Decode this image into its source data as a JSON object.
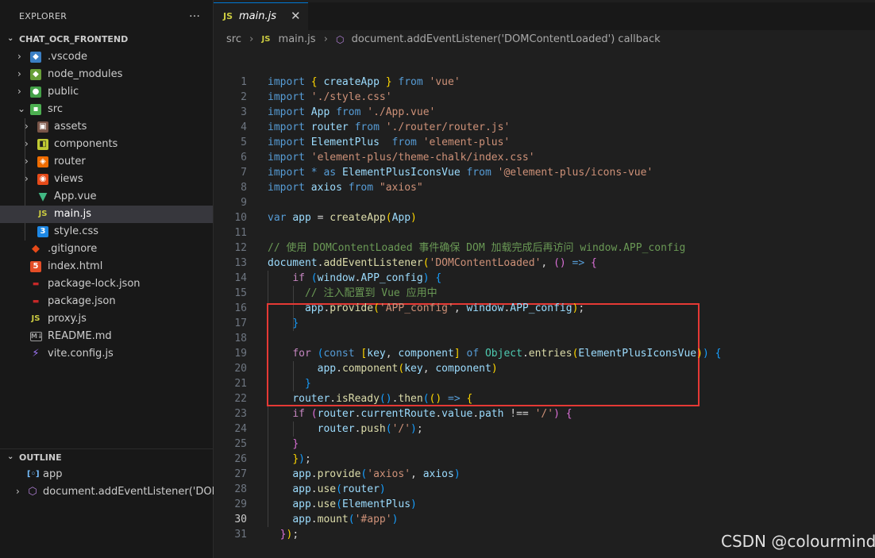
{
  "explorer": {
    "title": "EXPLORER",
    "more_icon": "…",
    "project_name": "CHAT_OCR_FRONTEND",
    "items": [
      {
        "label": ".vscode",
        "icon": "vscode-folder-icon"
      },
      {
        "label": "node_modules",
        "icon": "node-folder-icon"
      },
      {
        "label": "public",
        "icon": "public-folder-icon"
      },
      {
        "label": "src",
        "icon": "src-folder-icon"
      },
      {
        "label": "assets",
        "icon": "assets-folder-icon"
      },
      {
        "label": "components",
        "icon": "components-folder-icon"
      },
      {
        "label": "router",
        "icon": "router-folder-icon"
      },
      {
        "label": "views",
        "icon": "views-folder-icon"
      },
      {
        "label": "App.vue",
        "icon": "vue-file-icon"
      },
      {
        "label": "main.js",
        "icon": "js-file-icon"
      },
      {
        "label": "style.css",
        "icon": "css-file-icon"
      },
      {
        "label": ".gitignore",
        "icon": "git-file-icon"
      },
      {
        "label": "index.html",
        "icon": "html-file-icon"
      },
      {
        "label": "package-lock.json",
        "icon": "json-file-icon"
      },
      {
        "label": "package.json",
        "icon": "json-file-icon"
      },
      {
        "label": "proxy.js",
        "icon": "js-file-icon"
      },
      {
        "label": "README.md",
        "icon": "markdown-file-icon"
      },
      {
        "label": "vite.config.js",
        "icon": "vite-file-icon"
      }
    ]
  },
  "outline": {
    "title": "OUTLINE",
    "items": [
      {
        "label": "app",
        "icon": "variable-icon"
      },
      {
        "label": "document.addEventListener('DOMC...",
        "icon": "method-icon"
      }
    ]
  },
  "tab": {
    "badge": "JS",
    "label": "main.js",
    "close": "✕"
  },
  "breadcrumb": {
    "folder": "src",
    "file_badge": "JS",
    "file": "main.js",
    "symbol": "document.addEventListener('DOMContentLoaded') callback"
  },
  "editor": {
    "active_line": 30,
    "lines": [
      [
        [
          "kw",
          "import"
        ],
        [
          "t",
          " "
        ],
        [
          "b1",
          "{"
        ],
        [
          "t",
          " "
        ],
        [
          "var",
          "createApp"
        ],
        [
          "t",
          " "
        ],
        [
          "b1",
          "}"
        ],
        [
          "t",
          " "
        ],
        [
          "kw",
          "from"
        ],
        [
          "t",
          " "
        ],
        [
          "str",
          "'vue'"
        ]
      ],
      [
        [
          "kw",
          "import"
        ],
        [
          "t",
          " "
        ],
        [
          "str",
          "'./style.css'"
        ]
      ],
      [
        [
          "kw",
          "import"
        ],
        [
          "t",
          " "
        ],
        [
          "var",
          "App"
        ],
        [
          "t",
          " "
        ],
        [
          "kw",
          "from"
        ],
        [
          "t",
          " "
        ],
        [
          "str",
          "'./App.vue'"
        ]
      ],
      [
        [
          "kw",
          "import"
        ],
        [
          "t",
          " "
        ],
        [
          "var",
          "router"
        ],
        [
          "t",
          " "
        ],
        [
          "kw",
          "from"
        ],
        [
          "t",
          " "
        ],
        [
          "str",
          "'./router/router.js'"
        ]
      ],
      [
        [
          "kw",
          "import"
        ],
        [
          "t",
          " "
        ],
        [
          "var",
          "ElementPlus"
        ],
        [
          "t",
          "  "
        ],
        [
          "kw",
          "from"
        ],
        [
          "t",
          " "
        ],
        [
          "str",
          "'element-plus'"
        ]
      ],
      [
        [
          "kw",
          "import"
        ],
        [
          "t",
          " "
        ],
        [
          "str",
          "'element-plus/theme-chalk/index.css'"
        ]
      ],
      [
        [
          "kw",
          "import"
        ],
        [
          "t",
          " "
        ],
        [
          "kw",
          "*"
        ],
        [
          "t",
          " "
        ],
        [
          "kw",
          "as"
        ],
        [
          "t",
          " "
        ],
        [
          "var",
          "ElementPlusIconsVue"
        ],
        [
          "t",
          " "
        ],
        [
          "kw",
          "from"
        ],
        [
          "t",
          " "
        ],
        [
          "str",
          "'@element-plus/icons-vue'"
        ]
      ],
      [
        [
          "kw",
          "import"
        ],
        [
          "t",
          " "
        ],
        [
          "var",
          "axios"
        ],
        [
          "t",
          " "
        ],
        [
          "kw",
          "from"
        ],
        [
          "t",
          " "
        ],
        [
          "str",
          "\"axios\""
        ]
      ],
      [],
      [
        [
          "kw",
          "var"
        ],
        [
          "t",
          " "
        ],
        [
          "var",
          "app"
        ],
        [
          "t",
          " "
        ],
        [
          "pun",
          "="
        ],
        [
          "t",
          " "
        ],
        [
          "fn",
          "createApp"
        ],
        [
          "b1",
          "("
        ],
        [
          "var",
          "App"
        ],
        [
          "b1",
          ")"
        ]
      ],
      [],
      [
        [
          "com",
          "// 使用 DOMContentLoaded 事件确保 DOM 加载完成后再访问 window.APP_config"
        ]
      ],
      [
        [
          "var",
          "document"
        ],
        [
          "pun",
          "."
        ],
        [
          "fn",
          "addEventListener"
        ],
        [
          "b1",
          "("
        ],
        [
          "str",
          "'DOMContentLoaded'"
        ],
        [
          "pun",
          ", "
        ],
        [
          "b2",
          "()"
        ],
        [
          "t",
          " "
        ],
        [
          "kw",
          "=>"
        ],
        [
          "t",
          " "
        ],
        [
          "b2",
          "{"
        ]
      ],
      [
        [
          "t",
          "    "
        ],
        [
          "ctl",
          "if"
        ],
        [
          "t",
          " "
        ],
        [
          "b3",
          "("
        ],
        [
          "var",
          "window"
        ],
        [
          "pun",
          "."
        ],
        [
          "var",
          "APP_config"
        ],
        [
          "b3",
          ")"
        ],
        [
          "t",
          " "
        ],
        [
          "b3",
          "{"
        ]
      ],
      [
        [
          "t",
          "      "
        ],
        [
          "com",
          "// 注入配置到 Vue 应用中"
        ]
      ],
      [
        [
          "t",
          "      "
        ],
        [
          "var",
          "app"
        ],
        [
          "pun",
          "."
        ],
        [
          "fn",
          "provide"
        ],
        [
          "b1",
          "("
        ],
        [
          "str",
          "'APP_config'"
        ],
        [
          "pun",
          ", "
        ],
        [
          "var",
          "window"
        ],
        [
          "pun",
          "."
        ],
        [
          "var",
          "APP_config"
        ],
        [
          "b1",
          ")"
        ],
        [
          "pun",
          ";"
        ]
      ],
      [
        [
          "t",
          "    "
        ],
        [
          "b3",
          "}"
        ]
      ],
      [],
      [
        [
          "t",
          "    "
        ],
        [
          "ctl",
          "for"
        ],
        [
          "t",
          " "
        ],
        [
          "b3",
          "("
        ],
        [
          "kw",
          "const"
        ],
        [
          "t",
          " "
        ],
        [
          "b1",
          "["
        ],
        [
          "var",
          "key"
        ],
        [
          "pun",
          ", "
        ],
        [
          "var",
          "component"
        ],
        [
          "b1",
          "]"
        ],
        [
          "t",
          " "
        ],
        [
          "kw",
          "of"
        ],
        [
          "t",
          " "
        ],
        [
          "cls",
          "Object"
        ],
        [
          "pun",
          "."
        ],
        [
          "fn",
          "entries"
        ],
        [
          "b1",
          "("
        ],
        [
          "var",
          "ElementPlusIconsVue"
        ],
        [
          "b1",
          ")"
        ],
        [
          "b3",
          ")"
        ],
        [
          "t",
          " "
        ],
        [
          "b3",
          "{"
        ]
      ],
      [
        [
          "t",
          "        "
        ],
        [
          "var",
          "app"
        ],
        [
          "pun",
          "."
        ],
        [
          "fn",
          "component"
        ],
        [
          "b1",
          "("
        ],
        [
          "var",
          "key"
        ],
        [
          "pun",
          ", "
        ],
        [
          "var",
          "component"
        ],
        [
          "b1",
          ")"
        ]
      ],
      [
        [
          "t",
          "      "
        ],
        [
          "b3",
          "}"
        ]
      ],
      [
        [
          "t",
          "    "
        ],
        [
          "var",
          "router"
        ],
        [
          "pun",
          "."
        ],
        [
          "fn",
          "isReady"
        ],
        [
          "b3",
          "()"
        ],
        [
          "pun",
          "."
        ],
        [
          "fn",
          "then"
        ],
        [
          "b3",
          "("
        ],
        [
          "b1",
          "()"
        ],
        [
          "t",
          " "
        ],
        [
          "kw",
          "=>"
        ],
        [
          "t",
          " "
        ],
        [
          "b1",
          "{"
        ]
      ],
      [
        [
          "t",
          "    "
        ],
        [
          "ctl",
          "if"
        ],
        [
          "t",
          " "
        ],
        [
          "b2",
          "("
        ],
        [
          "var",
          "router"
        ],
        [
          "pun",
          "."
        ],
        [
          "var",
          "currentRoute"
        ],
        [
          "pun",
          "."
        ],
        [
          "var",
          "value"
        ],
        [
          "pun",
          "."
        ],
        [
          "var",
          "path"
        ],
        [
          "t",
          " "
        ],
        [
          "pun",
          "!=="
        ],
        [
          "t",
          " "
        ],
        [
          "str",
          "'/'"
        ],
        [
          "b2",
          ")"
        ],
        [
          "t",
          " "
        ],
        [
          "b2",
          "{"
        ]
      ],
      [
        [
          "t",
          "        "
        ],
        [
          "var",
          "router"
        ],
        [
          "pun",
          "."
        ],
        [
          "fn",
          "push"
        ],
        [
          "b3",
          "("
        ],
        [
          "str",
          "'/'"
        ],
        [
          "b3",
          ")"
        ],
        [
          "pun",
          ";"
        ]
      ],
      [
        [
          "t",
          "    "
        ],
        [
          "b2",
          "}"
        ]
      ],
      [
        [
          "t",
          "    "
        ],
        [
          "b1",
          "}"
        ],
        [
          "b3",
          ")"
        ],
        [
          "pun",
          ";"
        ]
      ],
      [
        [
          "t",
          "    "
        ],
        [
          "var",
          "app"
        ],
        [
          "pun",
          "."
        ],
        [
          "fn",
          "provide"
        ],
        [
          "b3",
          "("
        ],
        [
          "str",
          "'axios'"
        ],
        [
          "pun",
          ", "
        ],
        [
          "var",
          "axios"
        ],
        [
          "b3",
          ")"
        ]
      ],
      [
        [
          "t",
          "    "
        ],
        [
          "var",
          "app"
        ],
        [
          "pun",
          "."
        ],
        [
          "fn",
          "use"
        ],
        [
          "b3",
          "("
        ],
        [
          "var",
          "router"
        ],
        [
          "b3",
          ")"
        ]
      ],
      [
        [
          "t",
          "    "
        ],
        [
          "var",
          "app"
        ],
        [
          "pun",
          "."
        ],
        [
          "fn",
          "use"
        ],
        [
          "b3",
          "("
        ],
        [
          "var",
          "ElementPlus"
        ],
        [
          "b3",
          ")"
        ]
      ],
      [
        [
          "t",
          "    "
        ],
        [
          "var",
          "app"
        ],
        [
          "pun",
          "."
        ],
        [
          "fn",
          "mount"
        ],
        [
          "b3",
          "("
        ],
        [
          "str",
          "'#app'"
        ],
        [
          "b3",
          ")"
        ]
      ],
      [
        [
          "t",
          "  "
        ],
        [
          "b2",
          "}"
        ],
        [
          "b1",
          ")"
        ],
        [
          "pun",
          ";"
        ]
      ]
    ]
  },
  "watermark": "CSDN @colourmind",
  "colors": {
    "highlight_box": "#e53935",
    "accent": "#0078d4"
  }
}
